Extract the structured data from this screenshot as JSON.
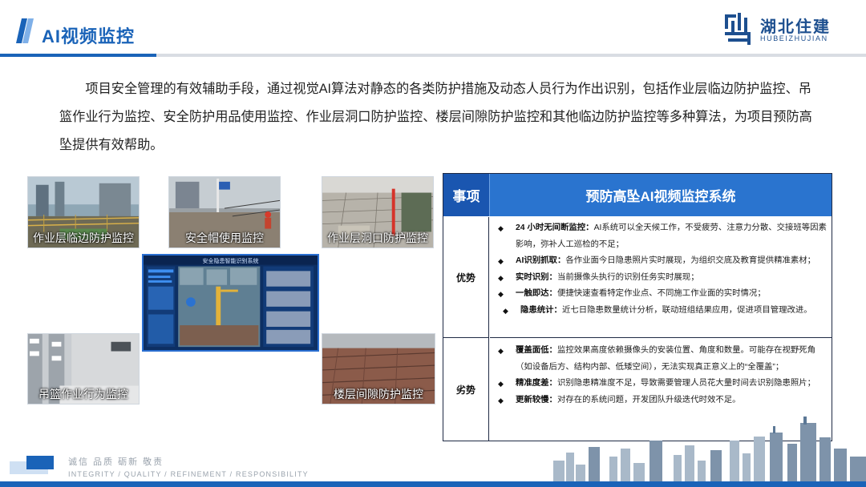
{
  "header": {
    "title": "AI视频监控",
    "logo_cn": "湖北住建",
    "logo_en": "HUBEIZHUJIAN"
  },
  "intro": "项目安全管理的有效辅助手段，通过视觉AI算法对静态的各类防护措施及动态人员行为作出识别，包括作业层临边防护监控、吊篮作业行为监控、安全防护用品使用监控、作业层洞口防护监控、楼层间隙防护监控和其他临边防护监控等多种算法，为项目预防高坠提供有效帮助。",
  "photos": [
    {
      "caption": "作业层临边防护监控"
    },
    {
      "caption": "安全帽使用监控"
    },
    {
      "caption": "作业层洞口防护监控"
    },
    {
      "caption": "吊篮作业行为监控"
    },
    {
      "caption": "楼层间隙防护监控"
    }
  ],
  "monitor": {
    "title": "安全隐患智能识别系统"
  },
  "table": {
    "col1": "事项",
    "col2": "预防高坠AI视频监控系统",
    "advantages_label": "优势",
    "advantages": [
      {
        "title": "24 小时无间断监控：",
        "text": "AI系统可以全天候工作，不受疲劳、注意力分散、交接班等因素影响，弥补人工巡检的不足；"
      },
      {
        "title": "AI识别抓取：",
        "text": "各作业面今日隐患照片实时展现，为组织交底及教育提供精准素材；"
      },
      {
        "title": "实时识别：",
        "text": "当前摄像头执行的识别任务实时展现；"
      },
      {
        "title": "一触即达：",
        "text": "便捷快速查看特定作业点、不同施工作业面的实时情况；"
      },
      {
        "title": "隐患统计：",
        "text": "近七日隐患数量统计分析，联动班组结果应用，促进项目管理改进。"
      }
    ],
    "disadvantages_label": "劣势",
    "disadvantages": [
      {
        "title": "覆盖面低：",
        "text": "监控效果高度依赖摄像头的安装位置、角度和数量。可能存在视野死角（如设备后方、结构内部、低矮空间），无法实现真正意义上的“全覆盖”；"
      },
      {
        "title": "精准度差：",
        "text": "识别隐患精准度不足，导致需要管理人员花大量时间去识别隐患照片；"
      },
      {
        "title": "更新较慢：",
        "text": "对存在的系统问题，开发团队升级迭代时效不足。"
      }
    ]
  },
  "footer": {
    "motto_cn": "诚信 品质 砺新 敬责",
    "motto_en": "INTEGRITY / QUALITY / REFINEMENT / RESPONSIBILITY"
  },
  "colors": {
    "brand": "#1a63b8",
    "table_header": "#2a74cf"
  },
  "icons": {
    "bullet": "diamond-bullet-icon"
  }
}
